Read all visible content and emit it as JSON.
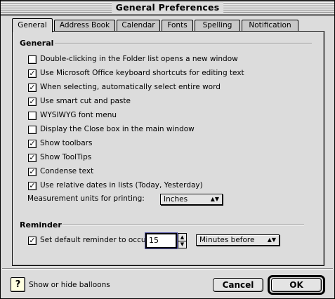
{
  "window": {
    "title": "General Preferences"
  },
  "tabs": [
    {
      "label": "General",
      "active": true
    },
    {
      "label": "Address Book",
      "active": false
    },
    {
      "label": "Calendar",
      "active": false
    },
    {
      "label": "Fonts",
      "active": false
    },
    {
      "label": "Spelling",
      "active": false
    },
    {
      "label": "Notification",
      "active": false
    }
  ],
  "general": {
    "title": "General",
    "options": [
      {
        "label": "Double-clicking in the Folder list opens a new window",
        "checked": false
      },
      {
        "label": "Use Microsoft Office keyboard shortcuts for editing text",
        "checked": true
      },
      {
        "label": "When selecting, automatically select entire word",
        "checked": true
      },
      {
        "label": "Use smart cut and paste",
        "checked": true
      },
      {
        "label": "WYSIWYG font menu",
        "checked": false
      },
      {
        "label": "Display the Close box in the main window",
        "checked": false
      },
      {
        "label": "Show toolbars",
        "checked": true
      },
      {
        "label": "Show ToolTips",
        "checked": true
      },
      {
        "label": "Condense text",
        "checked": true
      },
      {
        "label": "Use relative dates in lists (Today, Yesterday)",
        "checked": true
      }
    ],
    "measurement_label": "Measurement units for printing:",
    "measurement_value": "Inches"
  },
  "reminder": {
    "title": "Reminder",
    "option_label": "Set default reminder to occur",
    "option_checked": true,
    "amount": "15",
    "unit": "Minutes before"
  },
  "footer": {
    "help_label": "Show or hide balloons",
    "cancel_label": "Cancel",
    "ok_label": "OK"
  },
  "glyphs": {
    "check": "✓",
    "popup_arrows": "▲▼",
    "up": "▲",
    "down": "▼",
    "help": "?"
  }
}
